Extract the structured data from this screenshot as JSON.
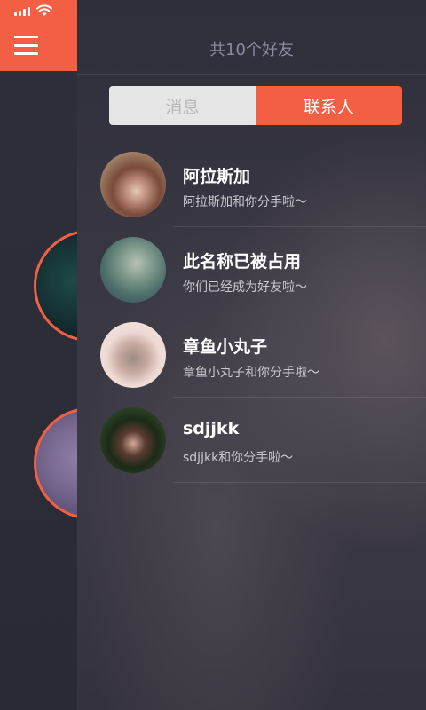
{
  "header": {
    "title": "共10个好友"
  },
  "tabs": [
    {
      "label": "消息",
      "active": false
    },
    {
      "label": "联系人",
      "active": true
    }
  ],
  "contacts": [
    {
      "name": "阿拉斯加",
      "preview": "阿拉斯加和你分手啦～"
    },
    {
      "name": "此名称已被占用",
      "preview": "你们已经成为好友啦～"
    },
    {
      "name": "章鱼小丸子",
      "preview": "章鱼小丸子和你分手啦～"
    },
    {
      "name": "sdjjkk",
      "preview": "sdjjkk和你分手啦～"
    }
  ],
  "colors": {
    "accent": "#f35f43",
    "background": "#2b2b36",
    "tab_inactive_bg": "#e6e6e6",
    "tab_inactive_text": "#b9b9b9"
  },
  "icons": {
    "menu": "hamburger-menu-icon",
    "signal": "cellular-signal-icon",
    "wifi": "wifi-icon"
  }
}
